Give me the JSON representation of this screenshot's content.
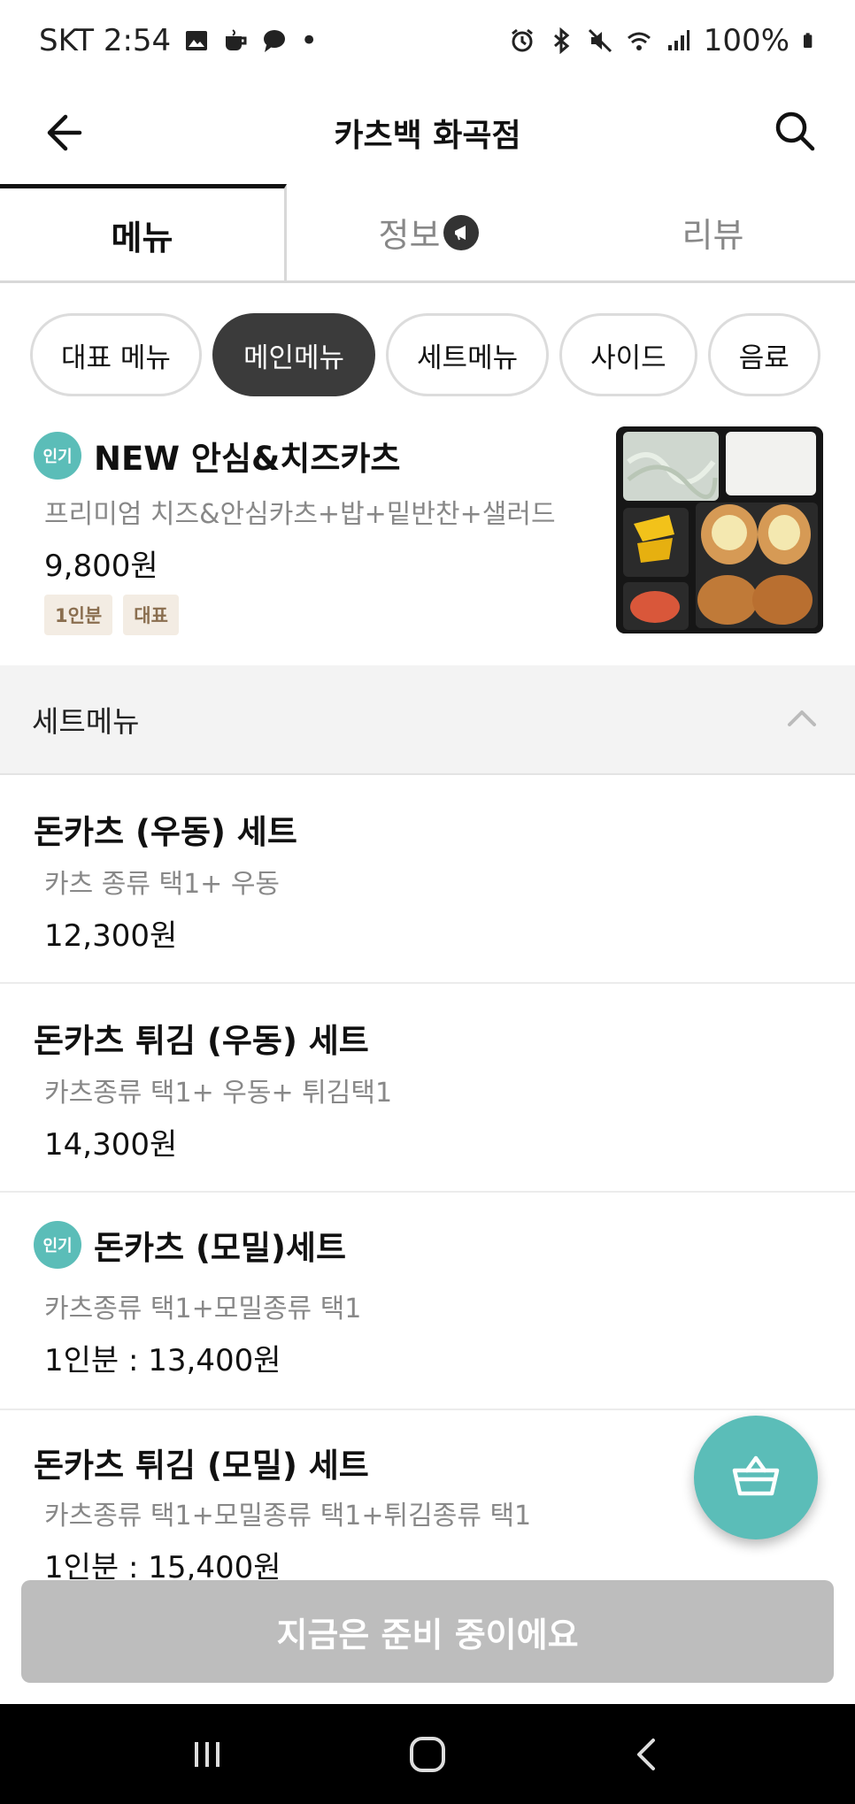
{
  "status_bar": {
    "carrier_time": "SKT 2:54",
    "battery": "100%",
    "dot": "•"
  },
  "header": {
    "title": "카츠백 화곡점"
  },
  "tabs": [
    {
      "label": "메뉴",
      "active": true
    },
    {
      "label": "정보",
      "active": false
    },
    {
      "label": "리뷰",
      "active": false
    }
  ],
  "chips": [
    {
      "label": "대표 메뉴",
      "active": false
    },
    {
      "label": "메인메뉴",
      "active": true
    },
    {
      "label": "세트메뉴",
      "active": false
    },
    {
      "label": "사이드",
      "active": false
    },
    {
      "label": "음료",
      "active": false
    }
  ],
  "featured": {
    "badge": "인기",
    "name": "NEW 안심&치즈카츠",
    "desc": "프리미엄 치즈&안심카츠+밥+밑반찬+샐러드",
    "price": "9,800원",
    "tags": [
      "1인분",
      "대표"
    ]
  },
  "section": {
    "title": "세트메뉴"
  },
  "items": [
    {
      "name": "돈카츠 (우동) 세트",
      "desc": "카츠 종류 택1+ 우동",
      "price": "12,300원"
    },
    {
      "name": "돈카츠 튀김 (우동) 세트",
      "desc": "카츠종류 택1+ 우동+ 튀김택1",
      "price": "14,300원"
    },
    {
      "badge": "인기",
      "name": "돈카츠 (모밀)세트",
      "desc": "카츠종류 택1+모밀종류 택1",
      "price": "1인분 : 13,400원"
    },
    {
      "name": "돈카츠 튀김 (모밀) 세트",
      "desc": "카츠종류 택1+모밀종류 택1+튀김종류 택1",
      "price": "1인분 : 15,400원"
    }
  ],
  "bottom_button": {
    "label": "지금은 준비 중이에요"
  },
  "colors": {
    "accent": "#5bbdb8",
    "chip_active": "#3b3b3b",
    "disabled_button": "#bdbdbd"
  },
  "icons": [
    "back-arrow-icon",
    "search-icon",
    "notice-icon",
    "chevron-up-icon",
    "basket-icon",
    "recent-apps-icon",
    "home-icon",
    "back-icon"
  ]
}
